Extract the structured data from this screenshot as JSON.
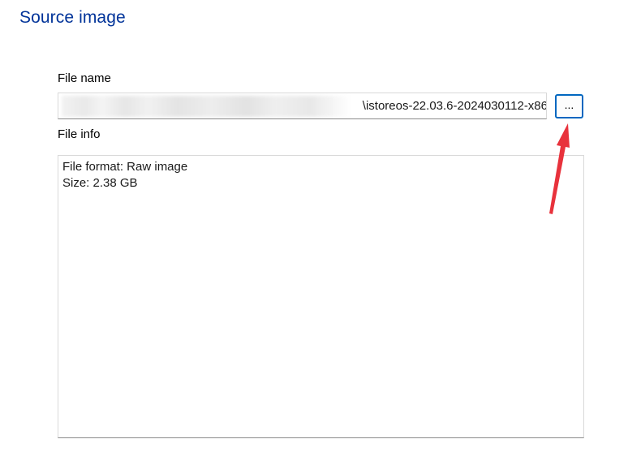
{
  "header": {
    "title": "Source image"
  },
  "file_name": {
    "label": "File name",
    "value": "\\istoreos-22.03.6-2024030112-x86",
    "browse_label": "..."
  },
  "file_info": {
    "label": "File info",
    "lines": [
      "File format: Raw image",
      "Size: 2.38 GB"
    ]
  },
  "annotation": {
    "icon": "red-arrow-icon",
    "color": "#e8323c"
  }
}
